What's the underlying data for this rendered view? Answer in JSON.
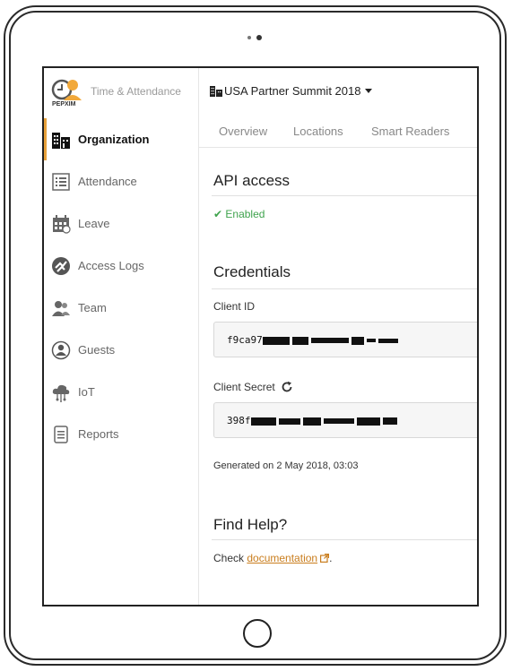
{
  "brand": {
    "title": "Time & Attendance",
    "name": "PEPXIM",
    "accent_color": "#e8a13a"
  },
  "sidebar": {
    "items": [
      {
        "label": "Organization",
        "icon": "building-icon",
        "active": true
      },
      {
        "label": "Attendance",
        "icon": "list-icon",
        "active": false
      },
      {
        "label": "Leave",
        "icon": "calendar-icon",
        "active": false
      },
      {
        "label": "Access Logs",
        "icon": "access-icon",
        "active": false
      },
      {
        "label": "Team",
        "icon": "team-icon",
        "active": false
      },
      {
        "label": "Guests",
        "icon": "guest-icon",
        "active": false
      },
      {
        "label": "IoT",
        "icon": "cloud-icon",
        "active": false
      },
      {
        "label": "Reports",
        "icon": "document-icon",
        "active": false
      }
    ]
  },
  "header": {
    "event_name": "USA Partner Summit 2018"
  },
  "tabs": [
    {
      "label": "Overview"
    },
    {
      "label": "Locations"
    },
    {
      "label": "Smart Readers"
    }
  ],
  "api": {
    "title": "API access",
    "status": "✔ Enabled",
    "status_color": "#3fa34d"
  },
  "credentials": {
    "title": "Credentials",
    "client_id_label": "Client ID",
    "client_id_value": "f9ca97",
    "client_secret_label": "Client Secret",
    "client_secret_value": "398f",
    "generated": "Generated on 2 May 2018, 03:03"
  },
  "help": {
    "title": "Find Help?",
    "prefix": "Check ",
    "link": "documentation",
    "suffix": "."
  }
}
